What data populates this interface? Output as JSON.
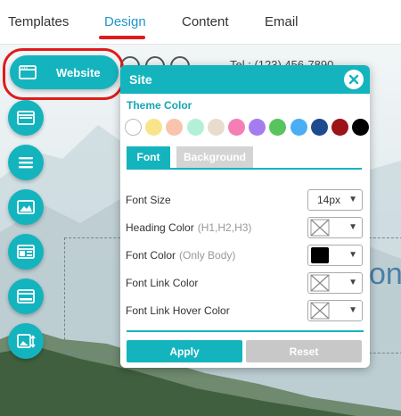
{
  "topnav": {
    "tabs": [
      {
        "label": "Templates"
      },
      {
        "label": "Design"
      },
      {
        "label": "Content"
      },
      {
        "label": "Email"
      }
    ],
    "active": "Design"
  },
  "header_partial": {
    "phone": "Tel.: (123) 456-7890"
  },
  "hero_partial_text": "on",
  "sidebar": {
    "website_label": "Website",
    "buttons": [
      {
        "icon": "browser-window-icon"
      },
      {
        "icon": "menu-icon"
      },
      {
        "icon": "image-icon"
      },
      {
        "icon": "layout-icon"
      },
      {
        "icon": "browser-window-icon"
      },
      {
        "icon": "image-resize-icon"
      }
    ]
  },
  "panel": {
    "title": "Site",
    "theme_color_label": "Theme Color",
    "swatches": [
      "#ffffff",
      "#fae48a",
      "#f8c4ad",
      "#b2f1d8",
      "#e9dccf",
      "#f57fb5",
      "#a57cf0",
      "#58c45d",
      "#4aaef4",
      "#1e4b8f",
      "#9c1318",
      "#000000"
    ],
    "tabs": {
      "font": "Font",
      "background": "Background"
    },
    "rows": [
      {
        "label": "Font Size",
        "sub": "",
        "value": "14px"
      },
      {
        "label": "Heading Color",
        "sub": "(H1,H2,H3)",
        "value": ""
      },
      {
        "label": "Font Color",
        "sub": "(Only Body)",
        "value": ""
      },
      {
        "label": "Font Link Color",
        "sub": "",
        "value": ""
      },
      {
        "label": "Font Link Hover Color",
        "sub": "",
        "value": ""
      }
    ],
    "font_color_value": "#000000",
    "apply_label": "Apply",
    "reset_label": "Reset"
  },
  "colors": {
    "accent": "#14b4be",
    "link_blue": "#2196c9",
    "annotation_red": "#e01b1b"
  }
}
